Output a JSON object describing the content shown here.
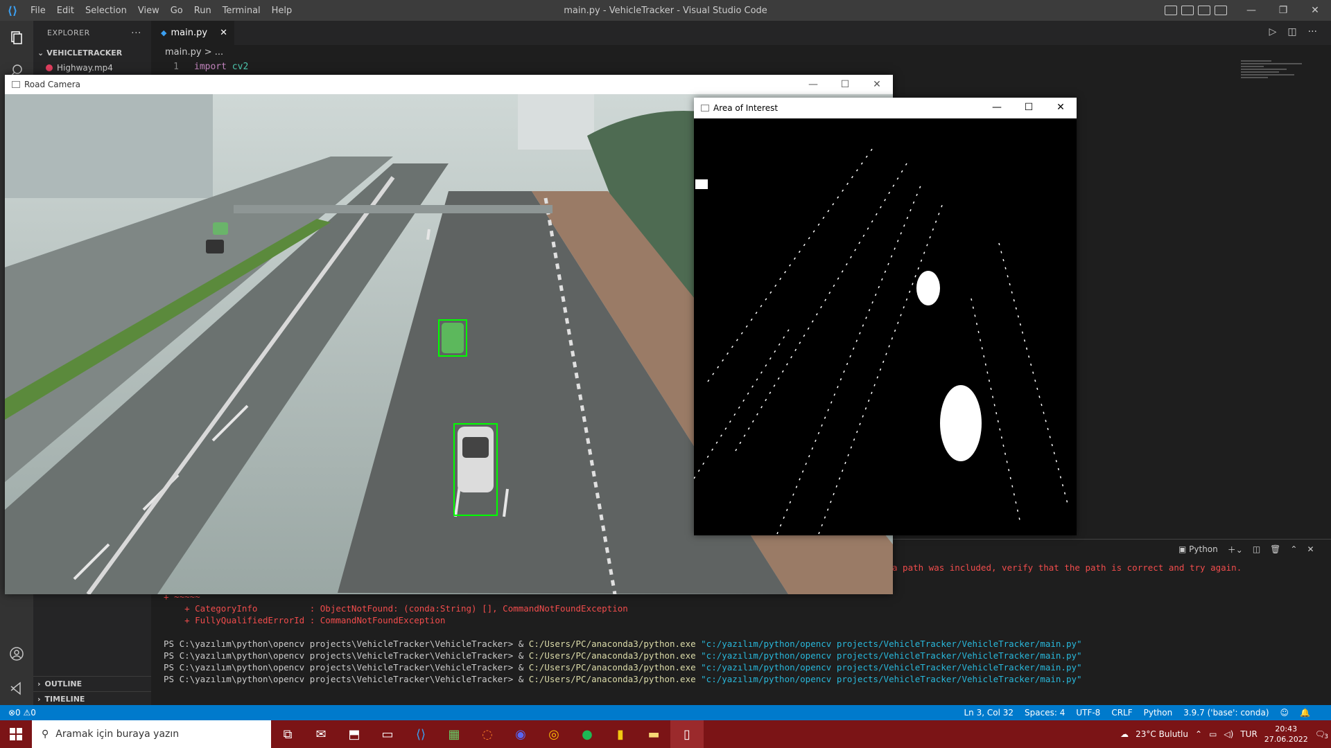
{
  "titlebar": {
    "menu": [
      "File",
      "Edit",
      "Selection",
      "View",
      "Go",
      "Run",
      "Terminal",
      "Help"
    ],
    "title": "main.py - VehicleTracker - Visual Studio Code",
    "controls": [
      "—",
      "❐",
      "✕"
    ]
  },
  "sidebar": {
    "header": "EXPLORER",
    "folder": "VEHICLETRACKER",
    "files": [
      "Highway.mp4"
    ],
    "outline": "OUTLINE",
    "timeline": "TIMELINE"
  },
  "editor": {
    "tab_label": "main.py",
    "breadcrumb": "main.py > ...",
    "lines": [
      {
        "num": "1",
        "kw": "import",
        "mod": "cv2"
      }
    ]
  },
  "road_window": {
    "title": "Road Camera",
    "controls": [
      "—",
      "☐",
      "✕"
    ]
  },
  "aoi_window": {
    "title": "Area of Interest",
    "controls": [
      "—",
      "☐",
      "✕"
    ]
  },
  "terminal": {
    "shell": "Python",
    "error_tail": "a path was included, verify that the path is correct and try again.",
    "lines": [
      {
        "text": "+ ~~~~~"
      },
      {
        "text": "    + CategoryInfo          : ObjectNotFound: (conda:String) [], CommandNotFoundException"
      },
      {
        "text": "    + FullyQualifiedErrorId : CommandNotFoundException"
      }
    ],
    "prompts": [
      {
        "ps": "PS C:\\yazılım\\python\\opencv projects\\VehicleTracker\\VehicleTracker> & ",
        "exe": "C:/Users/PC/anaconda3/python.exe",
        "arg": "\"c:/yazılım/python/opencv projects/VehicleTracker/VehicleTracker/main.py\""
      },
      {
        "ps": "PS C:\\yazılım\\python\\opencv projects\\VehicleTracker\\VehicleTracker> & ",
        "exe": "C:/Users/PC/anaconda3/python.exe",
        "arg": "\"c:/yazılım/python/opencv projects/VehicleTracker/VehicleTracker/main.py\""
      },
      {
        "ps": "PS C:\\yazılım\\python\\opencv projects\\VehicleTracker\\VehicleTracker> & ",
        "exe": "C:/Users/PC/anaconda3/python.exe",
        "arg": "\"c:/yazılım/python/opencv projects/VehicleTracker/VehicleTracker/main.py\""
      },
      {
        "ps": "PS C:\\yazılım\\python\\opencv projects\\VehicleTracker\\VehicleTracker> & ",
        "exe": "C:/Users/PC/anaconda3/python.exe",
        "arg": "\"c:/yazılım/python/opencv projects/VehicleTracker/VehicleTracker/main.py\""
      }
    ]
  },
  "statusbar": {
    "left": "⊗0 ⚠0",
    "items": [
      "Ln 3, Col 32",
      "Spaces: 4",
      "UTF-8",
      "CRLF",
      "Python",
      "3.9.7 ('base': conda)"
    ]
  },
  "taskbar": {
    "search_placeholder": "Aramak için buraya yazın",
    "weather": "23°C  Bulutlu",
    "lang": "TUR",
    "time": "20:43",
    "date": "27.06.2022",
    "notif_count": "3"
  },
  "colors": {
    "accent": "#007acc",
    "taskbar": "#7b1416",
    "detect_box": "#00ff00"
  }
}
